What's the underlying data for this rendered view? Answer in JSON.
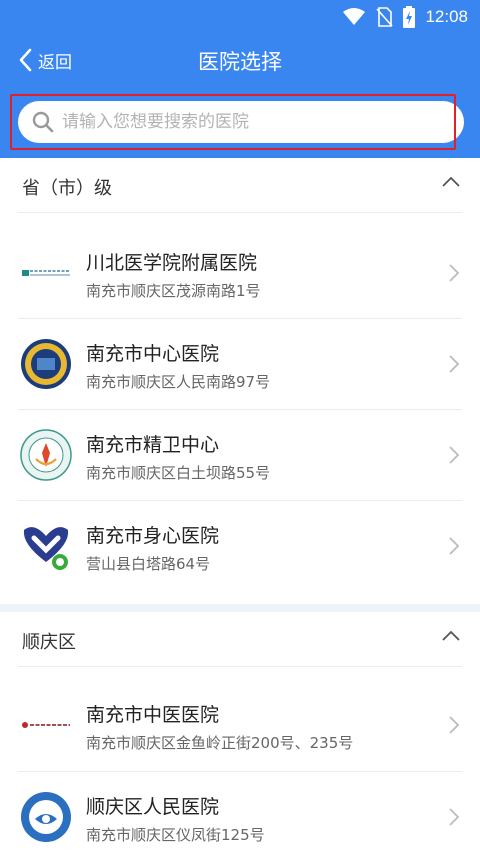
{
  "status": {
    "time": "12:08"
  },
  "nav": {
    "back_label": "返回",
    "title": "医院选择"
  },
  "search": {
    "placeholder": "请输入您想要搜索的医院"
  },
  "sections": [
    {
      "title": "省（市）级",
      "hospitals": [
        {
          "name": "川北医学院附属医院",
          "address": "南充市顺庆区茂源南路1号"
        },
        {
          "name": "南充市中心医院",
          "address": "南充市顺庆区人民南路97号"
        },
        {
          "name": "南充市精卫中心",
          "address": "南充市顺庆区白土坝路55号"
        },
        {
          "name": "南充市身心医院",
          "address": "营山县白塔路64号"
        }
      ]
    },
    {
      "title": "顺庆区",
      "hospitals": [
        {
          "name": "南充市中医医院",
          "address": "南充市顺庆区金鱼岭正街200号、235号"
        },
        {
          "name": "顺庆区人民医院",
          "address": "南充市顺庆区仪凤街125号"
        }
      ]
    }
  ],
  "colors": {
    "header": "#3a86f0",
    "highlight": "#e0202a"
  },
  "icons": {
    "back": "chevron-left-icon",
    "search": "search-icon",
    "collapse": "chevron-up-icon",
    "row": "chevron-right-icon"
  }
}
